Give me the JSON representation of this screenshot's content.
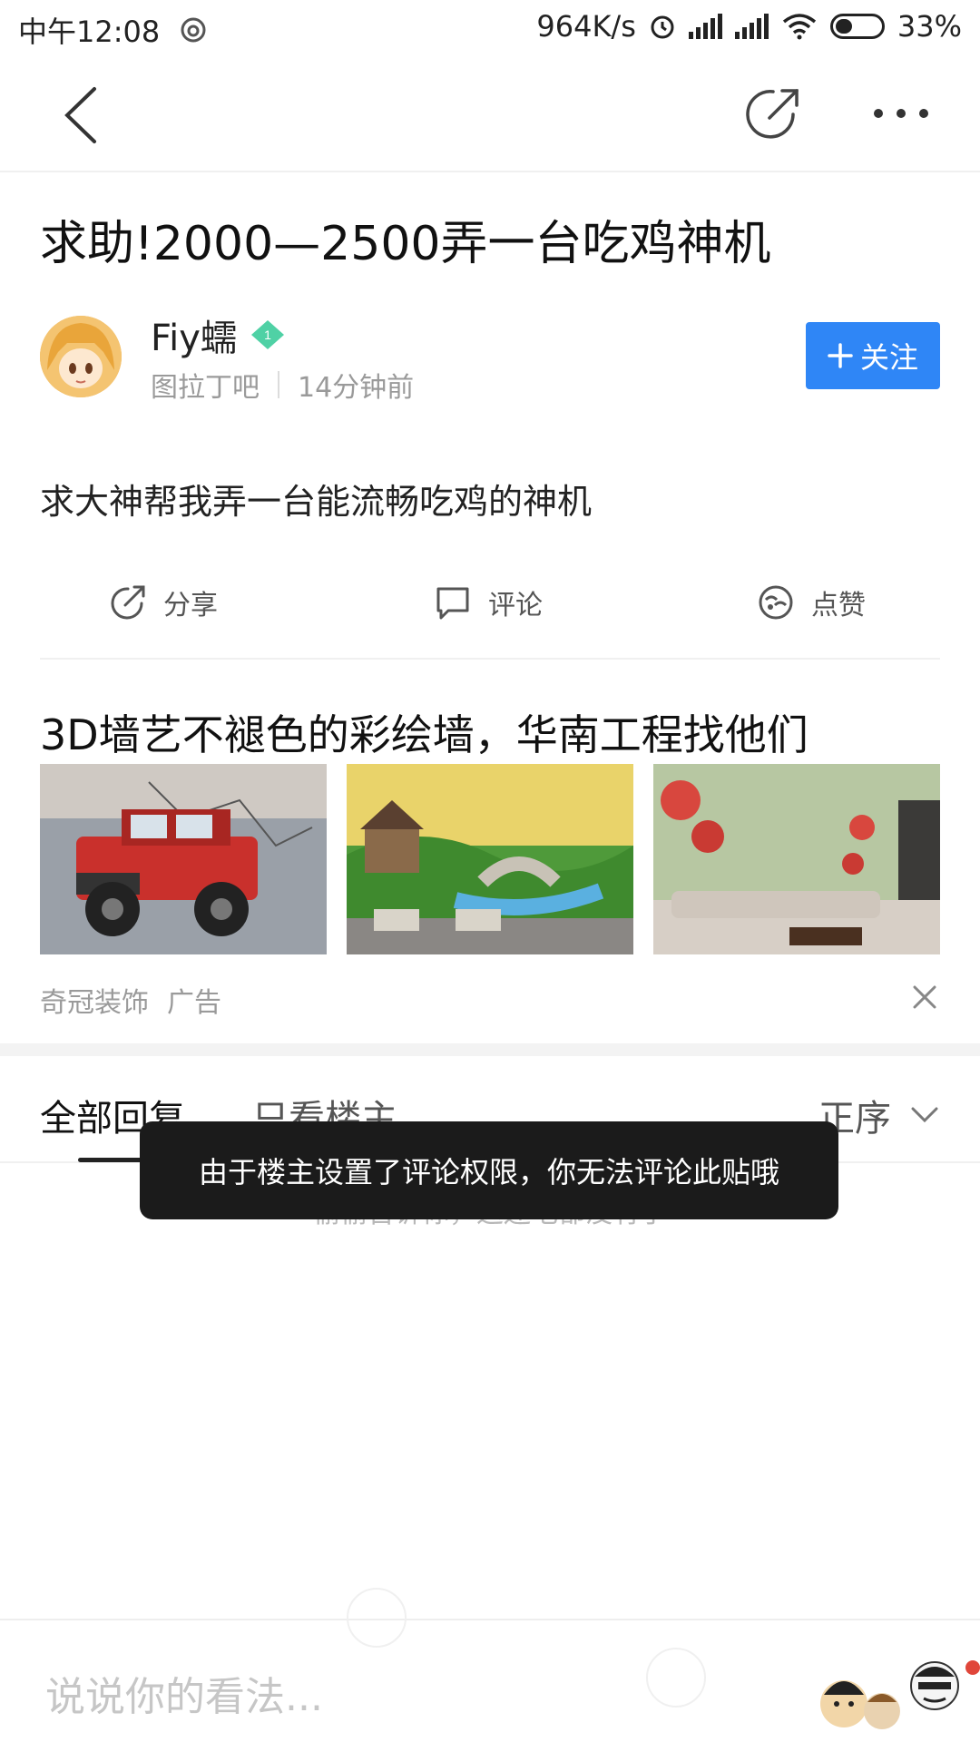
{
  "status_bar": {
    "time": "中午12:08",
    "net_speed": "964K/s",
    "battery": "33%"
  },
  "nav": {
    "icons": [
      "back-icon",
      "share-icon",
      "more-icon"
    ]
  },
  "post": {
    "title": "求助!2000—2500弄一台吃鸡神机",
    "author": "Fiy蠕",
    "level": "1",
    "forum": "图拉丁吧",
    "time_ago": "14分钟前",
    "follow_label": "关注",
    "body": "求大神帮我弄一台能流畅吃鸡的神机"
  },
  "actions": {
    "share": "分享",
    "comment": "评论",
    "like": "点赞"
  },
  "ad": {
    "title": "3D墙艺不褪色的彩绘墙，华南工程找他们",
    "source": "奇冠装饰",
    "tag": "广告"
  },
  "tabs": {
    "all": "全部回复",
    "op_only": "只看楼主",
    "sort": "正序"
  },
  "empty_message": "偷偷告诉你，这还毛都没有了",
  "toast": "由于楼主设置了评论权限，你无法评论此贴哦",
  "comment_placeholder": "说说你的看法...",
  "colors": {
    "accent": "#2f86f6",
    "toast_bg": "#1b1b1b",
    "level_badge": "#4fd1a5"
  }
}
